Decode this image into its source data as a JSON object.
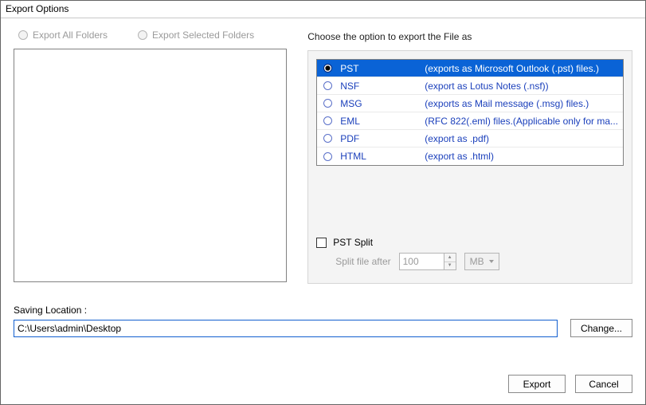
{
  "window": {
    "title": "Export Options"
  },
  "scope_radios": {
    "all": "Export All Folders",
    "selected": "Export Selected Folders",
    "enabled": false
  },
  "choose_label": "Choose the option to export the File as",
  "formats": [
    {
      "name": "PST",
      "desc": "(exports as Microsoft Outlook (.pst) files.)",
      "selected": true
    },
    {
      "name": "NSF",
      "desc": "(export as Lotus Notes (.nsf))",
      "selected": false
    },
    {
      "name": "MSG",
      "desc": "(exports as Mail message (.msg) files.)",
      "selected": false
    },
    {
      "name": "EML",
      "desc": "(RFC 822(.eml) files.(Applicable only for ma...",
      "selected": false
    },
    {
      "name": "PDF",
      "desc": "(export as .pdf)",
      "selected": false
    },
    {
      "name": "HTML",
      "desc": "(export as .html)",
      "selected": false
    }
  ],
  "pst_split": {
    "checkbox_label": "PST Split",
    "checked": false,
    "after_label": "Split file after",
    "value": "100",
    "unit": "MB",
    "enabled": false
  },
  "saving": {
    "label": "Saving Location :",
    "path": "C:\\Users\\admin\\Desktop",
    "change_label": "Change..."
  },
  "buttons": {
    "export": "Export",
    "cancel": "Cancel"
  }
}
